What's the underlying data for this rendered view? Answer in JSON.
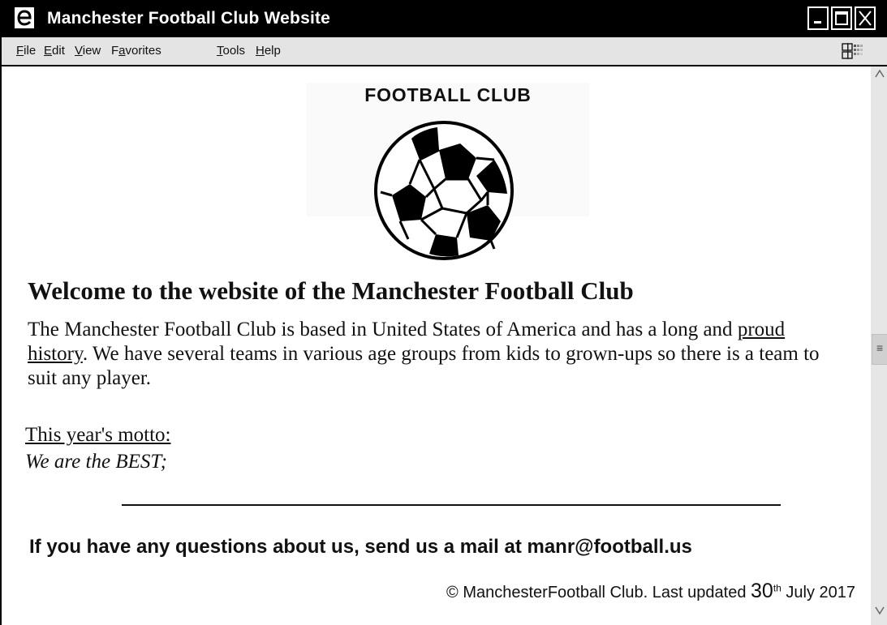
{
  "window": {
    "title": "Manchester Football Club Website",
    "app_icon": "ie-icon",
    "controls": [
      "minimize-icon",
      "maximize-icon",
      "close-icon"
    ]
  },
  "menu": {
    "items": [
      {
        "accel": "F",
        "rest": "ile"
      },
      {
        "accel": "E",
        "rest": "dit"
      },
      {
        "accel": "V",
        "rest": "iew"
      },
      {
        "pre": "F",
        "accel": "a",
        "rest": "vorites"
      },
      {
        "accel": "T",
        "rest": "ools"
      },
      {
        "accel": "H",
        "rest": "elp"
      }
    ]
  },
  "page": {
    "logo_title": "FOOTBALL CLUB",
    "logo_icon": "soccer-ball-icon",
    "heading": "Welcome to the website of the Manchester Football Club",
    "intro_part1": "The Manchester Football Club is based in United States of America and has a long and ",
    "intro_link": "proud history",
    "intro_part2": ". We have several teams in various age groups from kids to grown-ups so there is a team to suit any player.",
    "motto_label": "This year's motto:",
    "motto_text": "We are the BEST;",
    "contact": "If you have any questions about us, send us a mail at manr@football.us",
    "footer_prefix": "© ManchesterFootball Club. Last updated ",
    "footer_day": "30",
    "footer_day_suffix": "th",
    "footer_suffix": " July 2017"
  },
  "scrollbar": {
    "up_arrow": "^",
    "down_arrow": "v",
    "grip": "≡"
  },
  "colors": {
    "titlebar": "#000000",
    "menubar": "#e4e4e4",
    "scrollbar": "#e6e6e6",
    "text": "#111111"
  }
}
